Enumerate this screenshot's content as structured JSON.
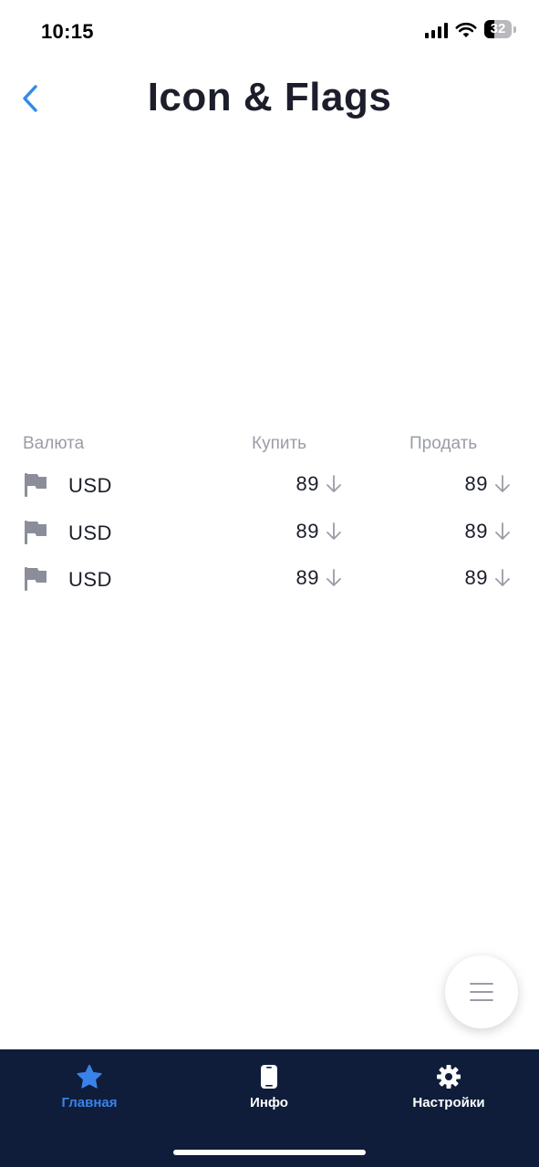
{
  "status_bar": {
    "time": "10:15",
    "battery": "32"
  },
  "header": {
    "title": "Icon & Flags",
    "back_icon": "chevron-left-icon"
  },
  "colors": {
    "accent": "#3a82ea",
    "tab_bar_bg": "#0f1d3a",
    "muted": "#9a9ca6",
    "text": "#1c1e2b"
  },
  "table": {
    "headers": {
      "currency": "Валюта",
      "buy": "Купить",
      "sell": "Продать"
    },
    "rows": [
      {
        "icon": "flag-icon",
        "code": "USD",
        "buy": "89",
        "buy_trend": "down",
        "sell": "89",
        "sell_trend": "down"
      },
      {
        "icon": "flag-icon",
        "code": "USD",
        "buy": "89",
        "buy_trend": "down",
        "sell": "89",
        "sell_trend": "down"
      },
      {
        "icon": "flag-icon",
        "code": "USD",
        "buy": "89",
        "buy_trend": "down",
        "sell": "89",
        "sell_trend": "down"
      }
    ]
  },
  "fab": {
    "icon": "menu-icon"
  },
  "tabs": [
    {
      "label": "Главная",
      "icon": "star-icon",
      "active": true
    },
    {
      "label": "Инфо",
      "icon": "phone-icon",
      "active": false
    },
    {
      "label": "Настройки",
      "icon": "gear-icon",
      "active": false
    }
  ]
}
